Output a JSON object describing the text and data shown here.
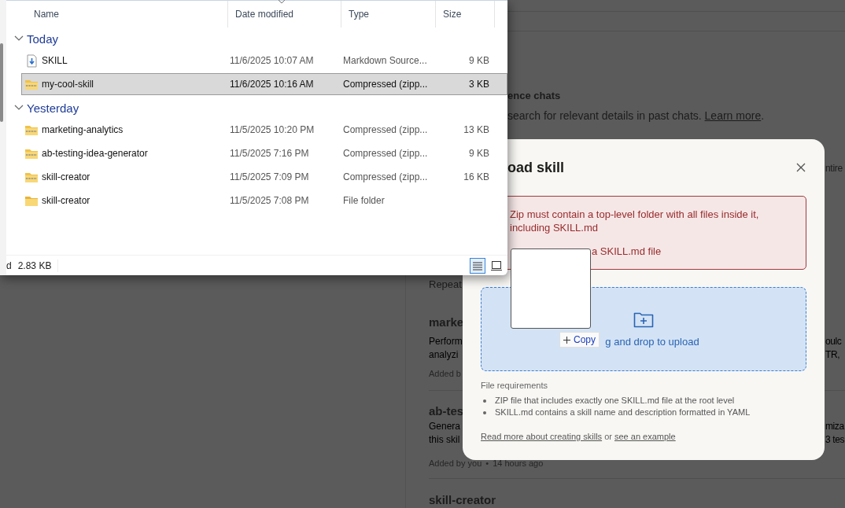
{
  "background": {
    "memory_title": "ence chats",
    "memory_text": "search for relevant details in past chats. ",
    "memory_link": "Learn more",
    "memory_end": ".",
    "right_fragment": "ntire",
    "previous_fragment": "Repeat",
    "skills": [
      {
        "name": "marke",
        "description": [
          "Perform",
          "analyzi"
        ],
        "right_lines": [
          "oulc",
          "TR,"
        ],
        "meta": "Added b"
      },
      {
        "name": "ab-tes",
        "description": [
          "Genera",
          "this skil"
        ],
        "right_lines": [
          "miza",
          "3 tes"
        ],
        "meta": "Added by you",
        "separator": "•",
        "age": "14 hours ago"
      },
      {
        "name": "skill-creator"
      }
    ]
  },
  "explorer": {
    "columns": [
      "Name",
      "Date modified",
      "Type",
      "Size"
    ],
    "groups": [
      {
        "label": "Today",
        "expanded": true,
        "rows": [
          {
            "kind": "markdown",
            "name": "SKILL",
            "date": "11/6/2025 10:07 AM",
            "type": "Markdown Source...",
            "size": "9 KB",
            "selected": false
          },
          {
            "kind": "zip",
            "name": "my-cool-skill",
            "date": "11/6/2025 10:16 AM",
            "type": "Compressed (zipp...",
            "size": "3 KB",
            "selected": true
          }
        ]
      },
      {
        "label": "Yesterday",
        "expanded": true,
        "rows": [
          {
            "kind": "zip",
            "name": "marketing-analytics",
            "date": "11/5/2025 10:20 PM",
            "type": "Compressed (zipp...",
            "size": "13 KB",
            "selected": false
          },
          {
            "kind": "zip",
            "name": "ab-testing-idea-generator",
            "date": "11/5/2025 7:16 PM",
            "type": "Compressed (zipp...",
            "size": "9 KB",
            "selected": false
          },
          {
            "kind": "zip",
            "name": "skill-creator",
            "date": "11/5/2025 7:09 PM",
            "type": "Compressed (zipp...",
            "size": "16 KB",
            "selected": false
          },
          {
            "kind": "folder",
            "name": "skill-creator",
            "date": "11/5/2025 7:08 PM",
            "type": "File folder",
            "selected": false
          }
        ]
      }
    ],
    "status_fragment": "d",
    "status_size": "2.83 KB",
    "views": [
      {
        "kind": "details",
        "selected": true
      },
      {
        "kind": "tiles",
        "selected": false
      }
    ]
  },
  "modal": {
    "title": "oad skill",
    "errors": [
      "Zip must contain a top-level folder with all files inside it, including SKILL.md",
      "a SKILL.md file"
    ],
    "dropzone": "g and drop to upload",
    "requirements_title": "File requirements",
    "requirements": [
      "ZIP file that includes exactly one SKILL.md file at the root level",
      "SKILL.md contains a skill name and description formatted in YAML"
    ],
    "footer_link": "Read more about creating skills",
    "footer_joiner": "or",
    "footer_link2": "see an example"
  },
  "drag": {
    "action": "Copy"
  }
}
